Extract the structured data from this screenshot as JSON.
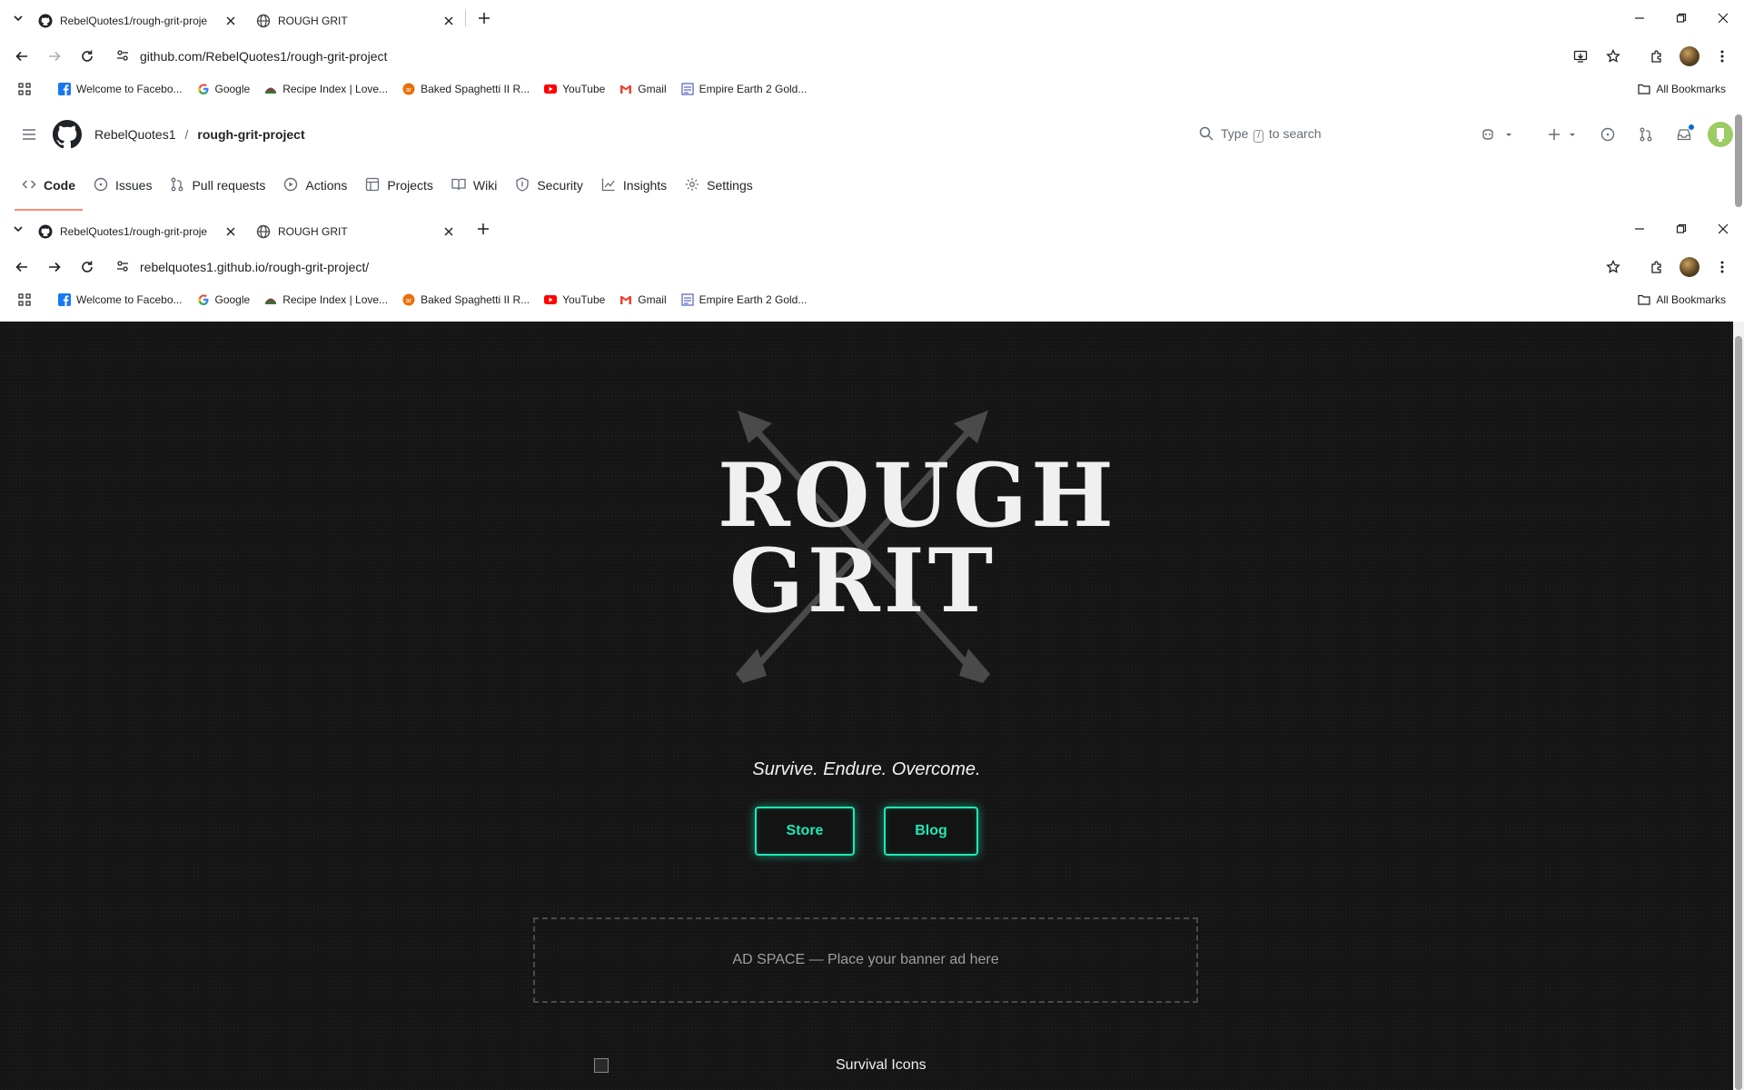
{
  "window1": {
    "tabs": [
      {
        "title": "RebelQuotes1/rough-grit-proje",
        "icon": "github-icon",
        "active": true
      },
      {
        "title": "ROUGH GRIT",
        "icon": "globe-icon",
        "active": false
      }
    ],
    "url": "github.com/RebelQuotes1/rough-grit-project"
  },
  "window2": {
    "tabs": [
      {
        "title": "RebelQuotes1/rough-grit-proje",
        "icon": "github-icon",
        "active": false
      },
      {
        "title": "ROUGH GRIT",
        "icon": "globe-icon",
        "active": true
      }
    ],
    "url": "rebelquotes1.github.io/rough-grit-project/"
  },
  "bookmarks": [
    {
      "label": "Welcome to Facebo...",
      "icon": "facebook-icon",
      "color": "#1877f2"
    },
    {
      "label": "Google",
      "icon": "google-icon",
      "color": "#4285f4"
    },
    {
      "label": "Recipe Index | Love...",
      "icon": "recipe-icon",
      "color": "#2e7d32"
    },
    {
      "label": "Baked Spaghetti II R...",
      "icon": "allrecipes-icon",
      "color": "#e8710a"
    },
    {
      "label": "YouTube",
      "icon": "youtube-icon",
      "color": "#ff0000"
    },
    {
      "label": "Gmail",
      "icon": "gmail-icon",
      "color": "#ea4335"
    },
    {
      "label": "Empire Earth 2 Gold...",
      "icon": "game-icon",
      "color": "#5c6bc0"
    }
  ],
  "all_bookmarks_label": "All Bookmarks",
  "github": {
    "owner": "RebelQuotes1",
    "separator": "/",
    "repo": "rough-grit-project",
    "search_prefix": "Type",
    "search_key": "/",
    "search_suffix": "to search",
    "nav": [
      {
        "label": "Code",
        "icon": "code-icon",
        "active": true
      },
      {
        "label": "Issues",
        "icon": "issue-icon"
      },
      {
        "label": "Pull requests",
        "icon": "pull-request-icon"
      },
      {
        "label": "Actions",
        "icon": "play-icon"
      },
      {
        "label": "Projects",
        "icon": "table-icon"
      },
      {
        "label": "Wiki",
        "icon": "book-icon"
      },
      {
        "label": "Security",
        "icon": "shield-icon"
      },
      {
        "label": "Insights",
        "icon": "graph-icon"
      },
      {
        "label": "Settings",
        "icon": "gear-icon"
      }
    ]
  },
  "site": {
    "logo_line1": "ROUGH",
    "logo_line2": "GRIT",
    "tagline": "Survive. Endure. Overcome.",
    "buttons": [
      {
        "label": "Store"
      },
      {
        "label": "Blog"
      }
    ],
    "ad_text": "AD SPACE — Place your banner ad here",
    "broken_image_alt": "Survival Icons",
    "accent": "#1de9b6",
    "background": "#151515"
  }
}
